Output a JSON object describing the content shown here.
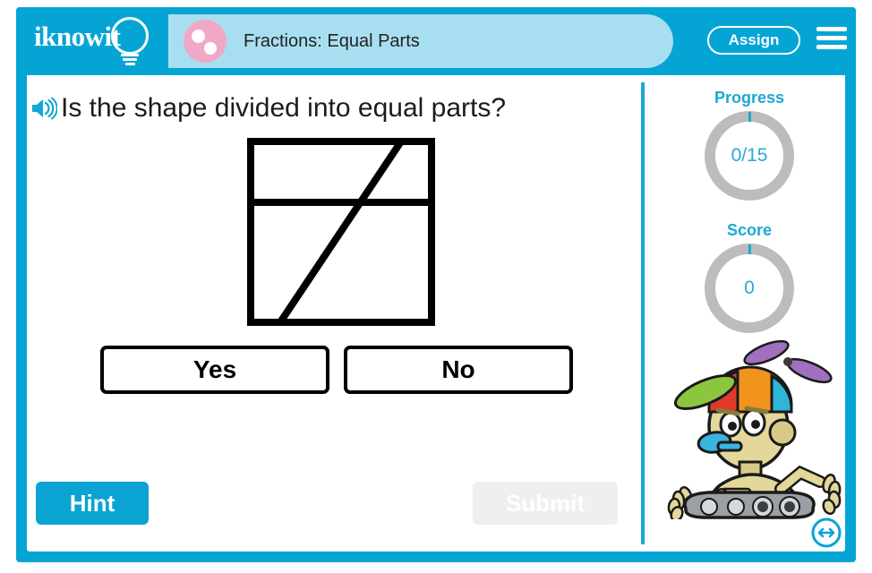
{
  "app": {
    "brand_name": "iknowit",
    "accent_color": "#04a5d5",
    "title_pill_color": "#a8dff0",
    "subject_icon_color": "#f0a8c8",
    "submit_color": "#56b55"
  },
  "header": {
    "lesson_title": "Fractions: Equal Parts",
    "assign_label": "Assign",
    "subject_icon": "two-dots-circle-icon",
    "menu_icon": "hamburger-menu-icon"
  },
  "question": {
    "speaker_icon": "speaker-audio-icon",
    "text": "Is the shape divided into equal parts?"
  },
  "figure": {
    "description": "square-divided-by-horizontal-and-diagonal-lines",
    "stroke_color": "#000000",
    "fill_color": "#ffffff"
  },
  "choices": [
    {
      "label": "Yes",
      "name": "answer-yes"
    },
    {
      "label": "No",
      "name": "answer-no"
    }
  ],
  "actions": {
    "hint_label": "Hint",
    "submit_label": "Submit"
  },
  "sidebar": {
    "progress": {
      "label": "Progress",
      "value": "0/15"
    },
    "score": {
      "label": "Score",
      "value": "0"
    },
    "mascot": "robot-mascot-with-propeller-hat"
  },
  "resize_icon": "resize-horizontal-icon"
}
